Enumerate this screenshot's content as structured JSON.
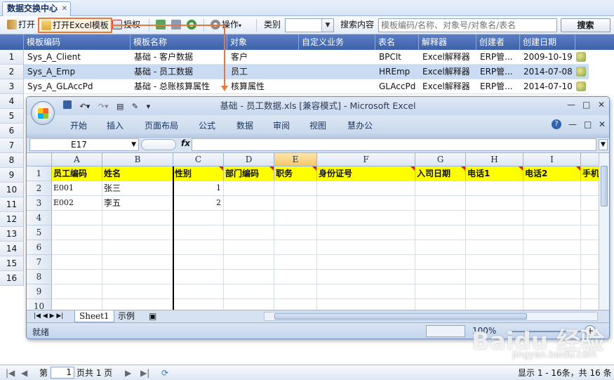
{
  "app": {
    "tab_title": "数据交换中心",
    "tab_close": "✕"
  },
  "toolbar": {
    "open": "打开",
    "open_excel_template": "打开Excel模板",
    "authorize": "授权",
    "operations": "操作",
    "category_label": "类别",
    "category_value": "",
    "search_label": "搜索内容",
    "search_placeholder": "模板编码/名称、对象号/对象名/表名",
    "search_button": "搜索"
  },
  "grid": {
    "columns": [
      "模板编码",
      "模板名称",
      "对象",
      "自定义业务",
      "表名",
      "解释器",
      "创建者",
      "创建日期"
    ],
    "rows": [
      {
        "n": "1",
        "cells": [
          "Sys_A_Client",
          "基础 - 客户数据",
          "客户",
          "",
          "BPClt",
          "Excel解释器",
          "ERP管...",
          "2009-10-19"
        ]
      },
      {
        "n": "2",
        "cells": [
          "Sys_A_Emp",
          "基础 - 员工数据",
          "员工",
          "",
          "HREmp",
          "Excel解释器",
          "ERP管...",
          "2014-07-08"
        ]
      },
      {
        "n": "3",
        "cells": [
          "Sys_A_GLAccPd",
          "基础 - 总账核算属性",
          "核算属性",
          "",
          "GLAccPd",
          "Excel解释器",
          "ERP管...",
          "2014-07-10"
        ]
      }
    ],
    "row_numbers": [
      "4",
      "5",
      "6",
      "7",
      "8",
      "9",
      "10",
      "11",
      "12",
      "13",
      "14",
      "15",
      "16"
    ]
  },
  "excel": {
    "caption": "基础 - 员工数据.xls  [兼容模式] - Microsoft Excel",
    "qat_icons": [
      "save-icon",
      "undo-icon",
      "redo-icon",
      "print-preview-icon",
      "format-painter-icon"
    ],
    "window_controls": [
      "—",
      "□",
      "✕"
    ],
    "ribbon_tabs": [
      "开始",
      "插入",
      "页面布局",
      "公式",
      "数据",
      "审阅",
      "视图",
      "慧办公"
    ],
    "ribbon_controls": [
      "?",
      "—",
      "□",
      "✕"
    ],
    "name_box": "E17",
    "fx": "fx",
    "columns": [
      "A",
      "B",
      "C",
      "D",
      "E",
      "F",
      "G",
      "H",
      "I"
    ],
    "active_column": "E",
    "header_row": [
      "员工编码",
      "姓名",
      "性别",
      "部门编码",
      "职务",
      "身份证号",
      "入司日期",
      "电话1",
      "电话2",
      "手机"
    ],
    "data_rows": [
      [
        "E001",
        "张三",
        "1",
        "",
        "",
        "",
        "",
        "",
        "",
        ""
      ],
      [
        "E002",
        "李五",
        "2",
        "",
        "",
        "",
        "",
        "",
        "",
        ""
      ]
    ],
    "row_labels": [
      "1",
      "2",
      "3",
      "4",
      "5",
      "6",
      "7",
      "8",
      "9",
      "10"
    ],
    "sheet_tabs": [
      "Sheet1",
      "示例"
    ],
    "status_ready": "就绪",
    "zoom": "100%"
  },
  "pager": {
    "page_label": "第",
    "page_value": "1",
    "page_total": "页共 1 页",
    "display": "显示 1 - 16条，共 16 条"
  },
  "watermark": {
    "brand": "Baidu 经验",
    "url": "jingyan.baidu.com"
  },
  "colors": {
    "header_blue": "#4a6fb8",
    "selected_row": "#c9dcf4",
    "highlight_orange": "#e8783a",
    "excel_yellow": "#ffff00"
  }
}
